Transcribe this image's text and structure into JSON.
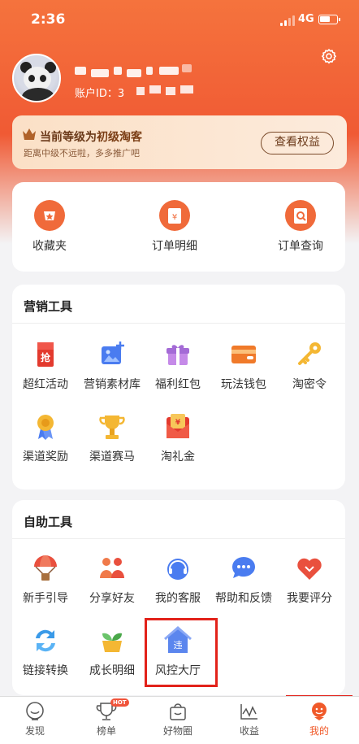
{
  "status_bar": {
    "time": "2:36",
    "network": "4G"
  },
  "profile": {
    "account_label": "账户ID：3"
  },
  "level": {
    "prefix": "当前等级为",
    "level_name": "初级淘客",
    "subtitle": "距离中级不远啦，多多推广吧",
    "button": "查看权益"
  },
  "quick": [
    {
      "label": "收藏夹",
      "icon": "favorites-icon"
    },
    {
      "label": "订单明细",
      "icon": "order-detail-icon"
    },
    {
      "label": "订单查询",
      "icon": "order-search-icon"
    }
  ],
  "marketing": {
    "title": "营销工具",
    "items": [
      {
        "label": "超红活动",
        "icon": "red-envelope-icon",
        "badge": "抢"
      },
      {
        "label": "营销素材库",
        "icon": "image-add-icon"
      },
      {
        "label": "福利红包",
        "icon": "gift-icon"
      },
      {
        "label": "玩法钱包",
        "icon": "wallet-icon"
      },
      {
        "label": "淘密令",
        "icon": "key-icon"
      },
      {
        "label": "渠道奖励",
        "icon": "medal-icon"
      },
      {
        "label": "渠道赛马",
        "icon": "trophy-icon"
      },
      {
        "label": "淘礼金",
        "icon": "cash-envelope-icon",
        "badge": "¥"
      }
    ]
  },
  "self_service": {
    "title": "自助工具",
    "items": [
      {
        "label": "新手引导",
        "icon": "parachute-icon"
      },
      {
        "label": "分享好友",
        "icon": "friends-icon"
      },
      {
        "label": "我的客服",
        "icon": "headset-icon"
      },
      {
        "label": "帮助和反馈",
        "icon": "chat-bubble-icon"
      },
      {
        "label": "我要评分",
        "icon": "heart-icon"
      },
      {
        "label": "链接转换",
        "icon": "convert-icon"
      },
      {
        "label": "成长明细",
        "icon": "plant-icon"
      },
      {
        "label": "风控大厅",
        "icon": "risk-control-icon",
        "badge": "违"
      }
    ]
  },
  "tabs": [
    {
      "label": "发现",
      "icon": "discover-icon"
    },
    {
      "label": "榜单",
      "icon": "trophy-tab-icon",
      "badge": "HOT"
    },
    {
      "label": "好物圈",
      "icon": "bag-icon"
    },
    {
      "label": "收益",
      "icon": "chart-line-icon"
    },
    {
      "label": "我的",
      "icon": "me-icon"
    }
  ],
  "colors": {
    "accent": "#f05a34",
    "highlight": "#e2221a"
  }
}
